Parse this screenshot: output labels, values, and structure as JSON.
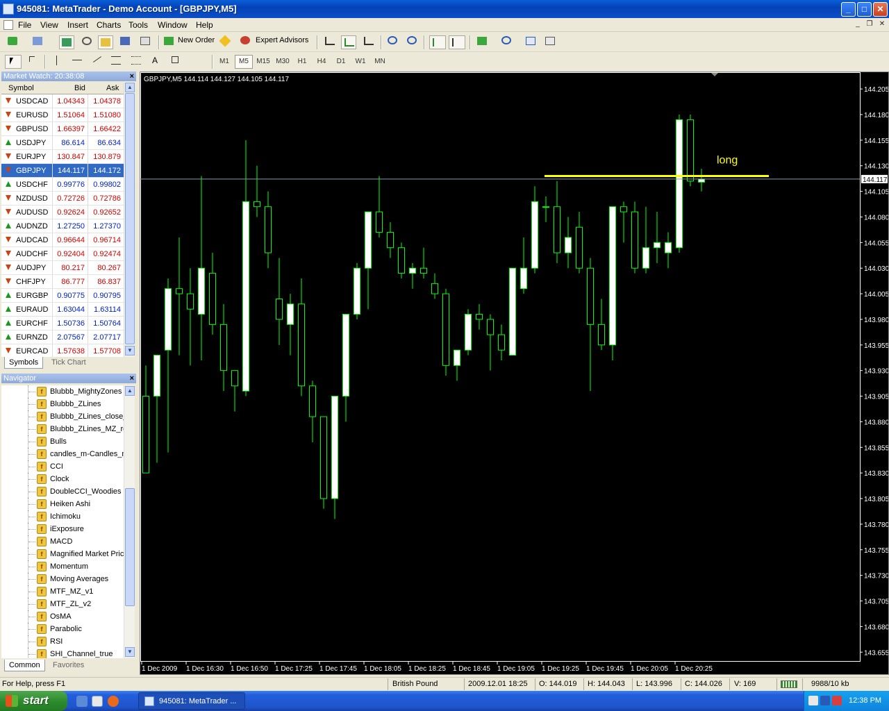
{
  "window": {
    "title": "945081: MetaTrader - Demo Account - [GBPJPY,M5]"
  },
  "menu": [
    "File",
    "View",
    "Insert",
    "Charts",
    "Tools",
    "Window",
    "Help"
  ],
  "toolbar": {
    "new_order": "New Order",
    "expert_advisors": "Expert Advisors"
  },
  "timeframes": [
    {
      "label": "M1",
      "active": false
    },
    {
      "label": "M5",
      "active": true
    },
    {
      "label": "M15",
      "active": false
    },
    {
      "label": "M30",
      "active": false
    },
    {
      "label": "H1",
      "active": false
    },
    {
      "label": "H4",
      "active": false
    },
    {
      "label": "D1",
      "active": false
    },
    {
      "label": "W1",
      "active": false
    },
    {
      "label": "MN",
      "active": false
    }
  ],
  "drawing_tools": {
    "text_tool": "A"
  },
  "market_watch": {
    "title": "Market Watch: 20:38:08",
    "columns": [
      "Symbol",
      "Bid",
      "Ask"
    ],
    "rows": [
      {
        "symbol": "USDCAD",
        "bid": "1.04343",
        "ask": "1.04378",
        "dir": "down",
        "color": "red"
      },
      {
        "symbol": "EURUSD",
        "bid": "1.51064",
        "ask": "1.51080",
        "dir": "down",
        "color": "red"
      },
      {
        "symbol": "GBPUSD",
        "bid": "1.66397",
        "ask": "1.66422",
        "dir": "down",
        "color": "red"
      },
      {
        "symbol": "USDJPY",
        "bid": "86.614",
        "ask": "86.634",
        "dir": "up",
        "color": "blue"
      },
      {
        "symbol": "EURJPY",
        "bid": "130.847",
        "ask": "130.879",
        "dir": "down",
        "color": "red"
      },
      {
        "symbol": "GBPJPY",
        "bid": "144.117",
        "ask": "144.172",
        "dir": "down",
        "color": "red",
        "selected": true
      },
      {
        "symbol": "USDCHF",
        "bid": "0.99776",
        "ask": "0.99802",
        "dir": "up",
        "color": "blue"
      },
      {
        "symbol": "NZDUSD",
        "bid": "0.72726",
        "ask": "0.72786",
        "dir": "down",
        "color": "red"
      },
      {
        "symbol": "AUDUSD",
        "bid": "0.92624",
        "ask": "0.92652",
        "dir": "down",
        "color": "red"
      },
      {
        "symbol": "AUDNZD",
        "bid": "1.27250",
        "ask": "1.27370",
        "dir": "up",
        "color": "blue"
      },
      {
        "symbol": "AUDCAD",
        "bid": "0.96644",
        "ask": "0.96714",
        "dir": "down",
        "color": "red"
      },
      {
        "symbol": "AUDCHF",
        "bid": "0.92404",
        "ask": "0.92474",
        "dir": "down",
        "color": "red"
      },
      {
        "symbol": "AUDJPY",
        "bid": "80.217",
        "ask": "80.267",
        "dir": "down",
        "color": "red"
      },
      {
        "symbol": "CHFJPY",
        "bid": "86.777",
        "ask": "86.837",
        "dir": "down",
        "color": "red"
      },
      {
        "symbol": "EURGBP",
        "bid": "0.90775",
        "ask": "0.90795",
        "dir": "up",
        "color": "blue"
      },
      {
        "symbol": "EURAUD",
        "bid": "1.63044",
        "ask": "1.63114",
        "dir": "up",
        "color": "blue"
      },
      {
        "symbol": "EURCHF",
        "bid": "1.50736",
        "ask": "1.50764",
        "dir": "up",
        "color": "blue"
      },
      {
        "symbol": "EURNZD",
        "bid": "2.07567",
        "ask": "2.07717",
        "dir": "up",
        "color": "blue"
      },
      {
        "symbol": "EURCAD",
        "bid": "1.57638",
        "ask": "1.57708",
        "dir": "down",
        "color": "red"
      }
    ],
    "tabs": [
      "Symbols",
      "Tick Chart"
    ]
  },
  "navigator": {
    "title": "Navigator",
    "items": [
      "Blubbb_MightyZones",
      "Blubbb_ZLines",
      "Blubbb_ZLines_close_",
      "Blubbb_ZLines_MZ_re",
      "Bulls",
      "candles_m-Candles_m",
      "CCI",
      "Clock",
      "DoubleCCI_Woodies",
      "Heiken Ashi",
      "Ichimoku",
      "iExposure",
      "MACD",
      "Magnified Market Price",
      "Momentum",
      "Moving Averages",
      "MTF_MZ_v1",
      "MTF_ZL_v2",
      "OsMA",
      "Parabolic",
      "RSI",
      "SHI_Channel_true"
    ],
    "tabs": [
      "Common",
      "Favorites"
    ]
  },
  "chart_data": {
    "type": "candlestick",
    "title": "GBPJPY,M5  144.114 144.127 144.105 144.117",
    "current_price": "144.117",
    "ylim": [
      143.64,
      144.215
    ],
    "y_ticks": [
      "144.205",
      "144.180",
      "144.155",
      "144.130",
      "144.105",
      "144.080",
      "144.055",
      "144.030",
      "144.005",
      "143.980",
      "143.955",
      "143.930",
      "143.905",
      "143.880",
      "143.855",
      "143.830",
      "143.805",
      "143.780",
      "143.755",
      "143.730",
      "143.705",
      "143.680",
      "143.655"
    ],
    "y_tick_values": [
      144.205,
      144.18,
      144.155,
      144.13,
      144.105,
      144.08,
      144.055,
      144.03,
      144.005,
      143.98,
      143.955,
      143.93,
      143.905,
      143.88,
      143.855,
      143.83,
      143.805,
      143.78,
      143.755,
      143.73,
      143.705,
      143.68,
      143.655
    ],
    "x_labels": [
      "1 Dec 2009",
      "1 Dec 16:30",
      "1 Dec 16:50",
      "1 Dec 17:25",
      "1 Dec 17:45",
      "1 Dec 18:05",
      "1 Dec 18:25",
      "1 Dec 18:45",
      "1 Dec 19:05",
      "1 Dec 19:25",
      "1 Dec 19:45",
      "1 Dec 20:05",
      "1 Dec 20:25"
    ],
    "candles": [
      {
        "o": 143.905,
        "h": 143.935,
        "l": 143.83,
        "c": 143.83
      },
      {
        "o": 143.905,
        "h": 143.935,
        "l": 143.84,
        "c": 143.945
      },
      {
        "o": 143.95,
        "h": 144.02,
        "l": 143.85,
        "c": 144.01
      },
      {
        "o": 144.01,
        "h": 144.06,
        "l": 143.945,
        "c": 144.005
      },
      {
        "o": 144.005,
        "h": 144.03,
        "l": 143.935,
        "c": 143.99
      },
      {
        "o": 143.985,
        "h": 144.12,
        "l": 143.94,
        "c": 144.03
      },
      {
        "o": 144.025,
        "h": 144.045,
        "l": 143.965,
        "c": 143.975
      },
      {
        "o": 143.975,
        "h": 143.995,
        "l": 143.91,
        "c": 143.93
      },
      {
        "o": 143.93,
        "h": 143.92,
        "l": 143.89,
        "c": 143.915
      },
      {
        "o": 143.91,
        "h": 144.155,
        "l": 143.905,
        "c": 144.095
      },
      {
        "o": 144.095,
        "h": 144.13,
        "l": 144.08,
        "c": 144.09
      },
      {
        "o": 144.09,
        "h": 144.105,
        "l": 144.03,
        "c": 144.045
      },
      {
        "o": 144.0,
        "h": 144.04,
        "l": 143.955,
        "c": 143.98
      },
      {
        "o": 143.975,
        "h": 144.005,
        "l": 143.945,
        "c": 143.995
      },
      {
        "o": 143.995,
        "h": 144.02,
        "l": 143.905,
        "c": 143.915
      },
      {
        "o": 143.915,
        "h": 143.92,
        "l": 143.86,
        "c": 143.885
      },
      {
        "o": 143.885,
        "h": 143.885,
        "l": 143.795,
        "c": 143.805
      },
      {
        "o": 143.805,
        "h": 143.905,
        "l": 143.785,
        "c": 143.905
      },
      {
        "o": 143.905,
        "h": 143.985,
        "l": 143.88,
        "c": 143.985
      },
      {
        "o": 143.985,
        "h": 144.035,
        "l": 143.98,
        "c": 144.03
      },
      {
        "o": 144.03,
        "h": 144.085,
        "l": 143.99,
        "c": 144.085
      },
      {
        "o": 144.085,
        "h": 144.12,
        "l": 144.06,
        "c": 144.065
      },
      {
        "o": 144.065,
        "h": 144.075,
        "l": 144.04,
        "c": 144.05
      },
      {
        "o": 144.05,
        "h": 144.055,
        "l": 144.02,
        "c": 144.025
      },
      {
        "o": 144.025,
        "h": 144.035,
        "l": 144.01,
        "c": 144.03
      },
      {
        "o": 144.03,
        "h": 144.05,
        "l": 144.02,
        "c": 144.025
      },
      {
        "o": 144.015,
        "h": 144.025,
        "l": 144.0,
        "c": 144.005
      },
      {
        "o": 144.005,
        "h": 144.01,
        "l": 143.925,
        "c": 143.935
      },
      {
        "o": 143.935,
        "h": 143.95,
        "l": 143.92,
        "c": 143.95
      },
      {
        "o": 143.95,
        "h": 143.99,
        "l": 143.945,
        "c": 143.985
      },
      {
        "o": 143.985,
        "h": 143.995,
        "l": 143.97,
        "c": 143.98
      },
      {
        "o": 143.98,
        "h": 143.985,
        "l": 143.93,
        "c": 143.965
      },
      {
        "o": 143.965,
        "h": 143.975,
        "l": 143.94,
        "c": 143.95
      },
      {
        "o": 143.945,
        "h": 144.03,
        "l": 143.945,
        "c": 144.03
      },
      {
        "o": 144.01,
        "h": 144.06,
        "l": 144.005,
        "c": 144.03
      },
      {
        "o": 144.03,
        "h": 144.11,
        "l": 144.025,
        "c": 144.095
      },
      {
        "o": 144.09,
        "h": 144.1,
        "l": 144.075,
        "c": 144.09
      },
      {
        "o": 144.09,
        "h": 144.115,
        "l": 144.035,
        "c": 144.045
      },
      {
        "o": 144.045,
        "h": 144.08,
        "l": 144.03,
        "c": 144.06
      },
      {
        "o": 144.07,
        "h": 144.085,
        "l": 144.025,
        "c": 144.03
      },
      {
        "o": 144.03,
        "h": 144.04,
        "l": 143.91,
        "c": 143.975
      },
      {
        "o": 143.975,
        "h": 144.0,
        "l": 143.95,
        "c": 143.955
      },
      {
        "o": 143.955,
        "h": 144.09,
        "l": 143.94,
        "c": 144.09
      },
      {
        "o": 144.09,
        "h": 144.095,
        "l": 144.055,
        "c": 144.085
      },
      {
        "o": 144.085,
        "h": 144.095,
        "l": 144.025,
        "c": 144.03
      },
      {
        "o": 144.03,
        "h": 144.09,
        "l": 144.025,
        "c": 144.05
      },
      {
        "o": 144.05,
        "h": 144.085,
        "l": 144.035,
        "c": 144.055
      },
      {
        "o": 144.045,
        "h": 144.065,
        "l": 144.03,
        "c": 144.055
      },
      {
        "o": 144.05,
        "h": 144.18,
        "l": 144.045,
        "c": 144.175
      },
      {
        "o": 144.175,
        "h": 144.18,
        "l": 144.11,
        "c": 144.115
      },
      {
        "o": 144.114,
        "h": 144.127,
        "l": 144.105,
        "c": 144.117
      }
    ],
    "annotation": {
      "text": "long",
      "price": 144.12,
      "color": "#ffff00"
    },
    "colors": {
      "background": "#000000",
      "bull_fill": "#ffffff",
      "bear_fill": "#000000",
      "wick": "#00ff00",
      "axis_text": "#ffffff",
      "price_line": "#8899aa"
    }
  },
  "status": {
    "help": "For Help, press F1",
    "instrument": "British Pound",
    "datetime": "2009.12.01 18:25",
    "open": "O: 144.019",
    "high": "H: 144.043",
    "low": "L: 143.996",
    "close": "C: 144.026",
    "volume": "V: 169",
    "traffic": "9988/10 kb"
  },
  "taskbar": {
    "start": "start",
    "task": "945081: MetaTrader ...",
    "clock": "12:38 PM"
  }
}
